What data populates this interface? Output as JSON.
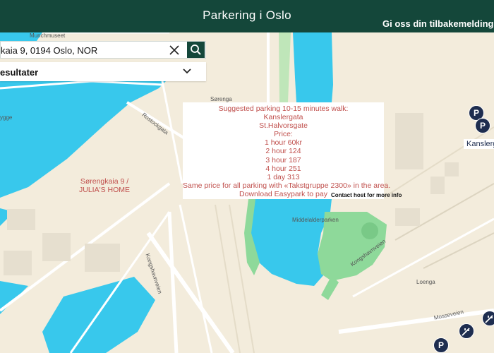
{
  "header": {
    "title": "Parkering i Oslo",
    "feedback_label": "Gi oss din tilbakemelding p"
  },
  "search": {
    "value": "kaia 9, 0194 Oslo, NOR",
    "clear_icon": "close-icon",
    "search_icon": "search-icon"
  },
  "results": {
    "label": "esultater",
    "toggle_icon": "chevron-down-icon"
  },
  "popup": {
    "lines": [
      "Suggested parking 10-15 minutes walk:",
      "Kanslergata",
      "St.Halvorsgate",
      "Price:",
      "1 hour 60kr",
      "2 hour 124",
      "3 hour 187",
      "4 hour 251",
      "1 day 313",
      "Same price for all parking with «Takstgruppe 2300» in the area.",
      "Download Easypark to pay"
    ],
    "contact": "Contact host for more info"
  },
  "map": {
    "labels": {
      "munchmuseet": "Munchmuseet",
      "sorenga": "Sørenga",
      "rostockgata": "Rostockgata",
      "middelalderparken": "Middelalderparken",
      "loenga": "Loenga",
      "kongshavnveien_left": "Kongshavnveien",
      "kongshavnveien_right": "Kongshavnveien",
      "mosseveien": "Mosseveien",
      "ygge": "ygge"
    },
    "home_label_line1": "Sørengkaia 9 /",
    "home_label_line2": "JULIA'S HOME",
    "kanslergata_label": "Kanslerg",
    "parking_letter": "P",
    "colors": {
      "header": "#14473a",
      "water": "#38c8ec",
      "land": "#f3ecdc",
      "park": "#8ed99a",
      "marker": "#1e2d4f",
      "popup_text": "#c0504d"
    }
  }
}
